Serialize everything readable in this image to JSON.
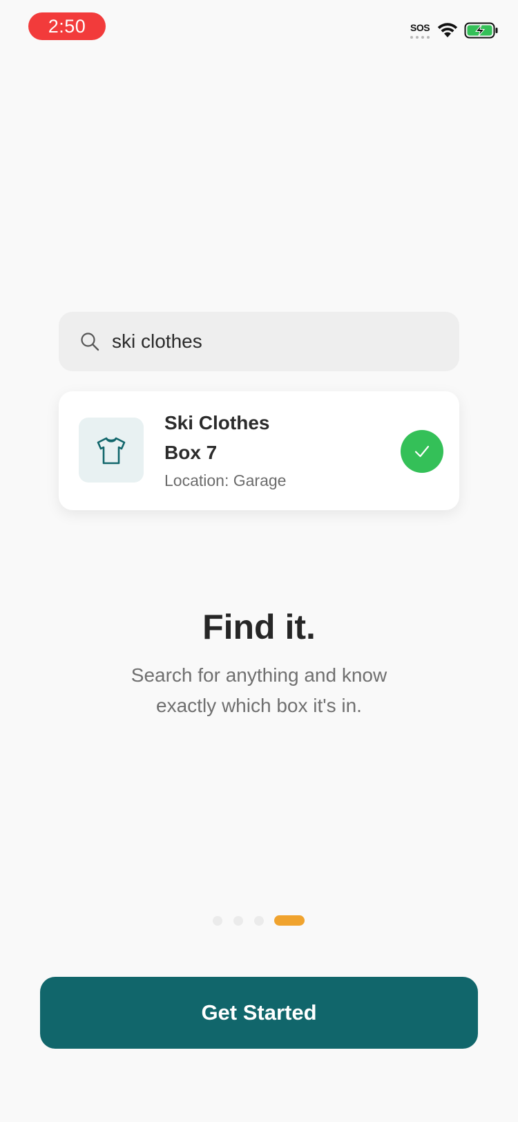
{
  "status_bar": {
    "time": "2:50",
    "sos_label": "SOS",
    "icons": [
      "wifi-icon",
      "battery-charging-icon"
    ]
  },
  "search": {
    "query": "ski clothes",
    "icon": "search-icon"
  },
  "result": {
    "name": "Ski Clothes",
    "box": "Box 7",
    "location": "Location: Garage",
    "thumbnail_icon": "shirt-icon",
    "status_icon": "checkmark-icon"
  },
  "onboarding": {
    "headline": "Find it.",
    "description": "Search for anything and know exactly which box it's in.",
    "page_count": 4,
    "current_page": 4
  },
  "cta": {
    "label": "Get Started"
  },
  "colors": {
    "background": "#f9f9f9",
    "time_pill": "#f23b3b",
    "search_bg": "#eeeeee",
    "thumb_bg": "#e8f1f2",
    "teal": "#11666b",
    "success": "#34c058",
    "active_dot": "#f0a32e",
    "inactive_dot": "#ebebeb"
  }
}
